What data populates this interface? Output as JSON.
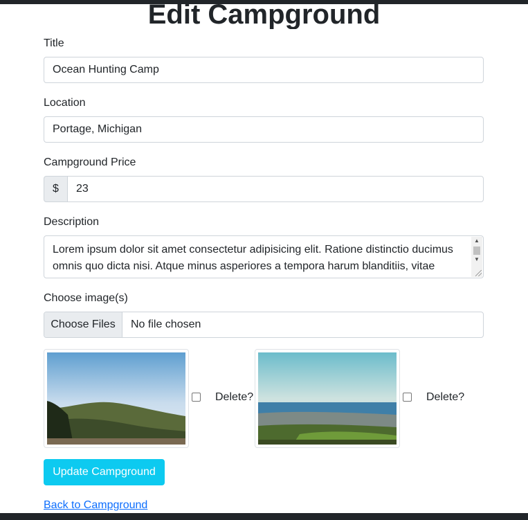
{
  "page": {
    "title": "Edit Campground"
  },
  "form": {
    "title": {
      "label": "Title",
      "value": "Ocean Hunting Camp"
    },
    "location": {
      "label": "Location",
      "value": "Portage, Michigan"
    },
    "price": {
      "label": "Campground Price",
      "currency": "$",
      "value": "23"
    },
    "description": {
      "label": "Description",
      "value": "Lorem ipsum dolor sit amet consectetur adipisicing elit. Ratione distinctio ducimus omnis quo dicta nisi. Atque minus asperiores a tempora harum blanditiis, vitae"
    },
    "images": {
      "label": "Choose image(s)",
      "button": "Choose Files",
      "status": "No file chosen"
    }
  },
  "thumbnails": [
    {
      "delete_label": "Delete?",
      "checked": false
    },
    {
      "delete_label": "Delete?",
      "checked": false
    }
  ],
  "actions": {
    "submit": "Update Campground",
    "back": "Back to Campground"
  },
  "colors": {
    "primary_button": "#0dcaf0",
    "link": "#0d6efd",
    "bar": "#212529"
  }
}
